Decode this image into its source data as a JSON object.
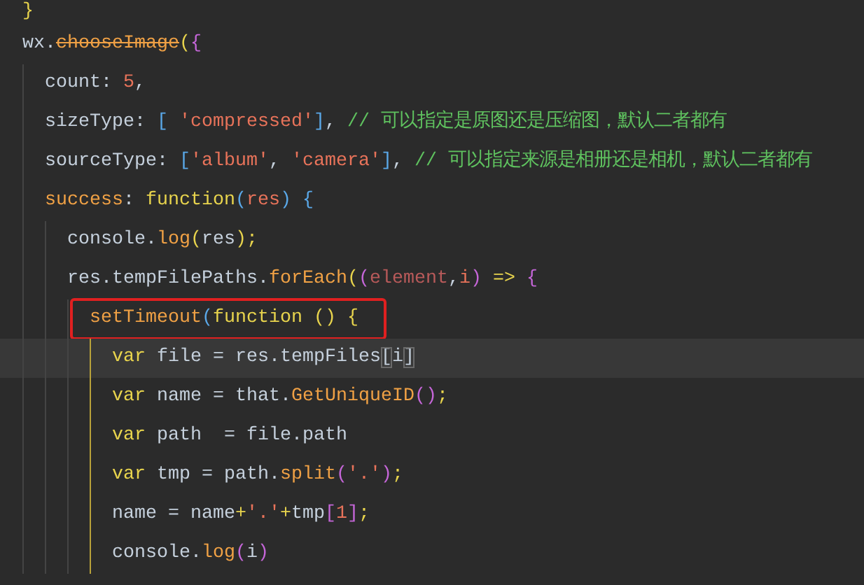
{
  "editor": {
    "lines": [
      {
        "current": false,
        "boxed": false,
        "active_scope": false,
        "tokens": [
          {
            "kind": "p1",
            "text": "  }"
          }
        ]
      },
      {
        "current": false,
        "boxed": false,
        "active_scope": false,
        "tokens": [
          {
            "kind": "plain",
            "text": "  wx."
          },
          {
            "kind": "deprecated",
            "text": "chooseImage"
          },
          {
            "kind": "p1",
            "text": "("
          },
          {
            "kind": "p2",
            "text": "{"
          }
        ]
      },
      {
        "current": false,
        "boxed": false,
        "active_scope": false,
        "tokens": [
          {
            "kind": "plain",
            "text": "    count: "
          },
          {
            "kind": "num",
            "text": "5"
          },
          {
            "kind": "plain",
            "text": ","
          }
        ]
      },
      {
        "current": false,
        "boxed": false,
        "active_scope": false,
        "tokens": [
          {
            "kind": "plain",
            "text": "    sizeType: "
          },
          {
            "kind": "p3",
            "text": "["
          },
          {
            "kind": "str",
            "text": " 'compressed'"
          },
          {
            "kind": "p3",
            "text": "]"
          },
          {
            "kind": "plain",
            "text": ", "
          },
          {
            "kind": "com",
            "text": "// 可以指定是原图还是压缩图，默认二者都有"
          }
        ]
      },
      {
        "current": false,
        "boxed": false,
        "active_scope": false,
        "tokens": [
          {
            "kind": "plain",
            "text": "    sourceType: "
          },
          {
            "kind": "p3",
            "text": "["
          },
          {
            "kind": "str",
            "text": "'album'"
          },
          {
            "kind": "plain",
            "text": ", "
          },
          {
            "kind": "str",
            "text": "'camera'"
          },
          {
            "kind": "p3",
            "text": "]"
          },
          {
            "kind": "plain",
            "text": ", "
          },
          {
            "kind": "com",
            "text": "// 可以指定来源是相册还是相机，默认二者都有"
          }
        ]
      },
      {
        "current": false,
        "boxed": false,
        "active_scope": false,
        "tokens": [
          {
            "kind": "fn",
            "text": "    success"
          },
          {
            "kind": "plain",
            "text": ": "
          },
          {
            "kind": "kw",
            "text": "function"
          },
          {
            "kind": "p3",
            "text": "("
          },
          {
            "kind": "param",
            "text": "res"
          },
          {
            "kind": "p3",
            "text": ")"
          },
          {
            "kind": "p3",
            "text": " {"
          }
        ]
      },
      {
        "current": false,
        "boxed": false,
        "active_scope": false,
        "tokens": [
          {
            "kind": "plain",
            "text": "      console."
          },
          {
            "kind": "fn",
            "text": "log"
          },
          {
            "kind": "p1",
            "text": "("
          },
          {
            "kind": "plain",
            "text": "res"
          },
          {
            "kind": "p1",
            "text": ")"
          },
          {
            "kind": "kw",
            "text": ";"
          }
        ]
      },
      {
        "current": false,
        "boxed": false,
        "active_scope": false,
        "tokens": [
          {
            "kind": "plain",
            "text": "      res.tempFilePaths."
          },
          {
            "kind": "fn",
            "text": "forEach"
          },
          {
            "kind": "p1",
            "text": "("
          },
          {
            "kind": "p2",
            "text": "("
          },
          {
            "kind": "param2",
            "text": "element"
          },
          {
            "kind": "plain",
            "text": ","
          },
          {
            "kind": "param",
            "text": "i"
          },
          {
            "kind": "p2",
            "text": ")"
          },
          {
            "kind": "op",
            "text": " =>"
          },
          {
            "kind": "p2",
            "text": " {"
          }
        ]
      },
      {
        "current": false,
        "boxed": true,
        "active_scope": false,
        "tokens": [
          {
            "kind": "fn",
            "text": "        setTimeout"
          },
          {
            "kind": "p3",
            "text": "("
          },
          {
            "kind": "kw",
            "text": "function"
          },
          {
            "kind": "p1",
            "text": " ()"
          },
          {
            "kind": "p1",
            "text": " {"
          }
        ]
      },
      {
        "current": true,
        "boxed": false,
        "active_scope": true,
        "tokens": [
          {
            "kind": "kw",
            "text": "          var"
          },
          {
            "kind": "plain",
            "text": " file = res.tempFiles"
          },
          {
            "kind": "match",
            "text": "["
          },
          {
            "kind": "plain",
            "text": "i"
          },
          {
            "kind": "match",
            "text": "]"
          }
        ]
      },
      {
        "current": false,
        "boxed": false,
        "active_scope": true,
        "tokens": [
          {
            "kind": "kw",
            "text": "          var"
          },
          {
            "kind": "plain",
            "text": " name = that."
          },
          {
            "kind": "fn",
            "text": "GetUniqueID"
          },
          {
            "kind": "p2",
            "text": "()"
          },
          {
            "kind": "kw",
            "text": ";"
          }
        ]
      },
      {
        "current": false,
        "boxed": false,
        "active_scope": true,
        "tokens": [
          {
            "kind": "kw",
            "text": "          var"
          },
          {
            "kind": "plain",
            "text": " path  = file.path"
          }
        ]
      },
      {
        "current": false,
        "boxed": false,
        "active_scope": true,
        "tokens": [
          {
            "kind": "kw",
            "text": "          var"
          },
          {
            "kind": "plain",
            "text": " tmp = path."
          },
          {
            "kind": "fn",
            "text": "split"
          },
          {
            "kind": "p2",
            "text": "("
          },
          {
            "kind": "str",
            "text": "'.'"
          },
          {
            "kind": "p2",
            "text": ")"
          },
          {
            "kind": "kw",
            "text": ";"
          }
        ]
      },
      {
        "current": false,
        "boxed": false,
        "active_scope": true,
        "tokens": [
          {
            "kind": "plain",
            "text": "          name = name"
          },
          {
            "kind": "op",
            "text": "+"
          },
          {
            "kind": "str",
            "text": "'.'"
          },
          {
            "kind": "op",
            "text": "+"
          },
          {
            "kind": "plain",
            "text": "tmp"
          },
          {
            "kind": "p2",
            "text": "["
          },
          {
            "kind": "num",
            "text": "1"
          },
          {
            "kind": "p2",
            "text": "]"
          },
          {
            "kind": "kw",
            "text": ";"
          }
        ]
      },
      {
        "current": false,
        "boxed": false,
        "active_scope": true,
        "tokens": [
          {
            "kind": "plain",
            "text": "          console."
          },
          {
            "kind": "fn",
            "text": "log"
          },
          {
            "kind": "p2",
            "text": "("
          },
          {
            "kind": "plain",
            "text": "i"
          },
          {
            "kind": "p2",
            "text": ")"
          }
        ]
      }
    ]
  }
}
